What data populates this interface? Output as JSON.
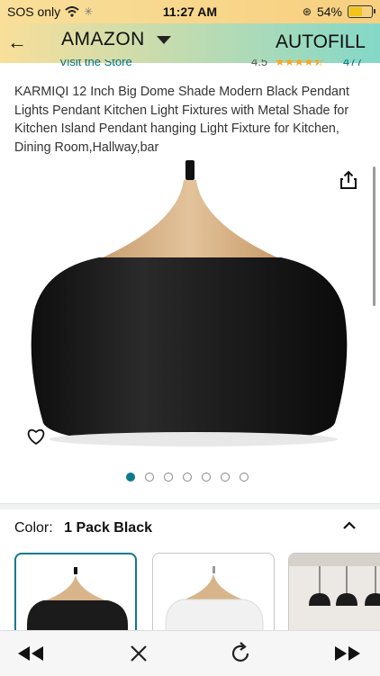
{
  "status": {
    "carrier": "SOS only",
    "time": "11:27 AM",
    "battery": "54%",
    "battery_level": 0.54
  },
  "nav": {
    "back_icon": "arrow-left-icon",
    "title": "AMAZON",
    "autofill": "AUTOFILL"
  },
  "peek": {
    "store_link": "Visit the Store",
    "rating": "4.5",
    "rating_count": "477"
  },
  "product": {
    "title": "KARMIQI 12 Inch Big Dome Shade Modern Black Pendant Lights Pendant Kitchen Light Fixtures with Metal Shade for Kitchen Island Pendant hanging Light Fixture for Kitchen, Dining Room,Hallway,bar",
    "image_count": 7,
    "active_image_index": 0
  },
  "color": {
    "label": "Color:",
    "value": "1 Pack Black"
  },
  "thumbnails": [
    {
      "variant": "black",
      "selected": true
    },
    {
      "variant": "white",
      "selected": false
    },
    {
      "variant": "multi-pack",
      "selected": false
    }
  ],
  "colors": {
    "accent": "#0f7a8a",
    "link": "#007185",
    "star": "#ffa41c",
    "shade": "#1b1b1b",
    "wood": "#d8b48a"
  }
}
